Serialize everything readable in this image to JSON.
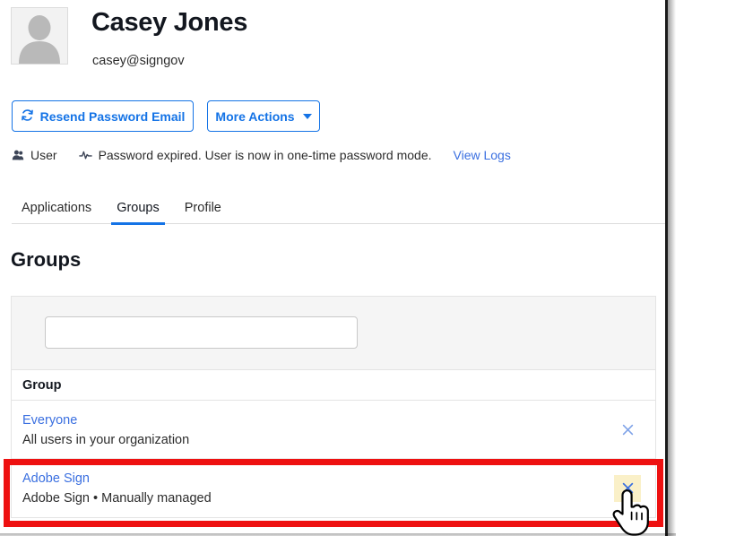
{
  "user": {
    "name": "Casey Jones",
    "email": "casey@signgov",
    "avatar_icon": "person-placeholder-icon"
  },
  "actions": {
    "resend_label": "Resend Password Email",
    "resend_icon": "refresh-icon",
    "more_label": "More Actions",
    "more_caret_icon": "caret-down-icon"
  },
  "status": {
    "type_icon": "user-icon",
    "type_label": "User",
    "message_icon": "activity-pulse-icon",
    "message": "Password expired. User is now in one-time password mode.",
    "logs_link": "View Logs"
  },
  "tabs": [
    {
      "label": "Applications",
      "active": false
    },
    {
      "label": "Groups",
      "active": true
    },
    {
      "label": "Profile",
      "active": false
    }
  ],
  "section": {
    "title": "Groups"
  },
  "search": {
    "value": "",
    "placeholder": ""
  },
  "table": {
    "column_header": "Group",
    "rows": [
      {
        "name": "Everyone",
        "description": "All users in your organization",
        "remove_icon": "close-x-icon",
        "highlighted": false
      },
      {
        "name": "Adobe Sign",
        "description": "Adobe Sign • Manually managed",
        "remove_icon": "close-x-icon",
        "highlighted": true
      }
    ]
  },
  "annotation": {
    "color": "#ee1111",
    "shape": "rectangle",
    "target": "adobe-sign-group-row"
  },
  "cursor": {
    "icon": "pointing-hand-cursor"
  },
  "colors": {
    "accent_blue": "#1473e6",
    "link_blue": "#3a6fe0",
    "highlight_yellow": "#faf0c8",
    "annotation_red": "#ee1111",
    "panel_gray": "#f5f5f5"
  }
}
